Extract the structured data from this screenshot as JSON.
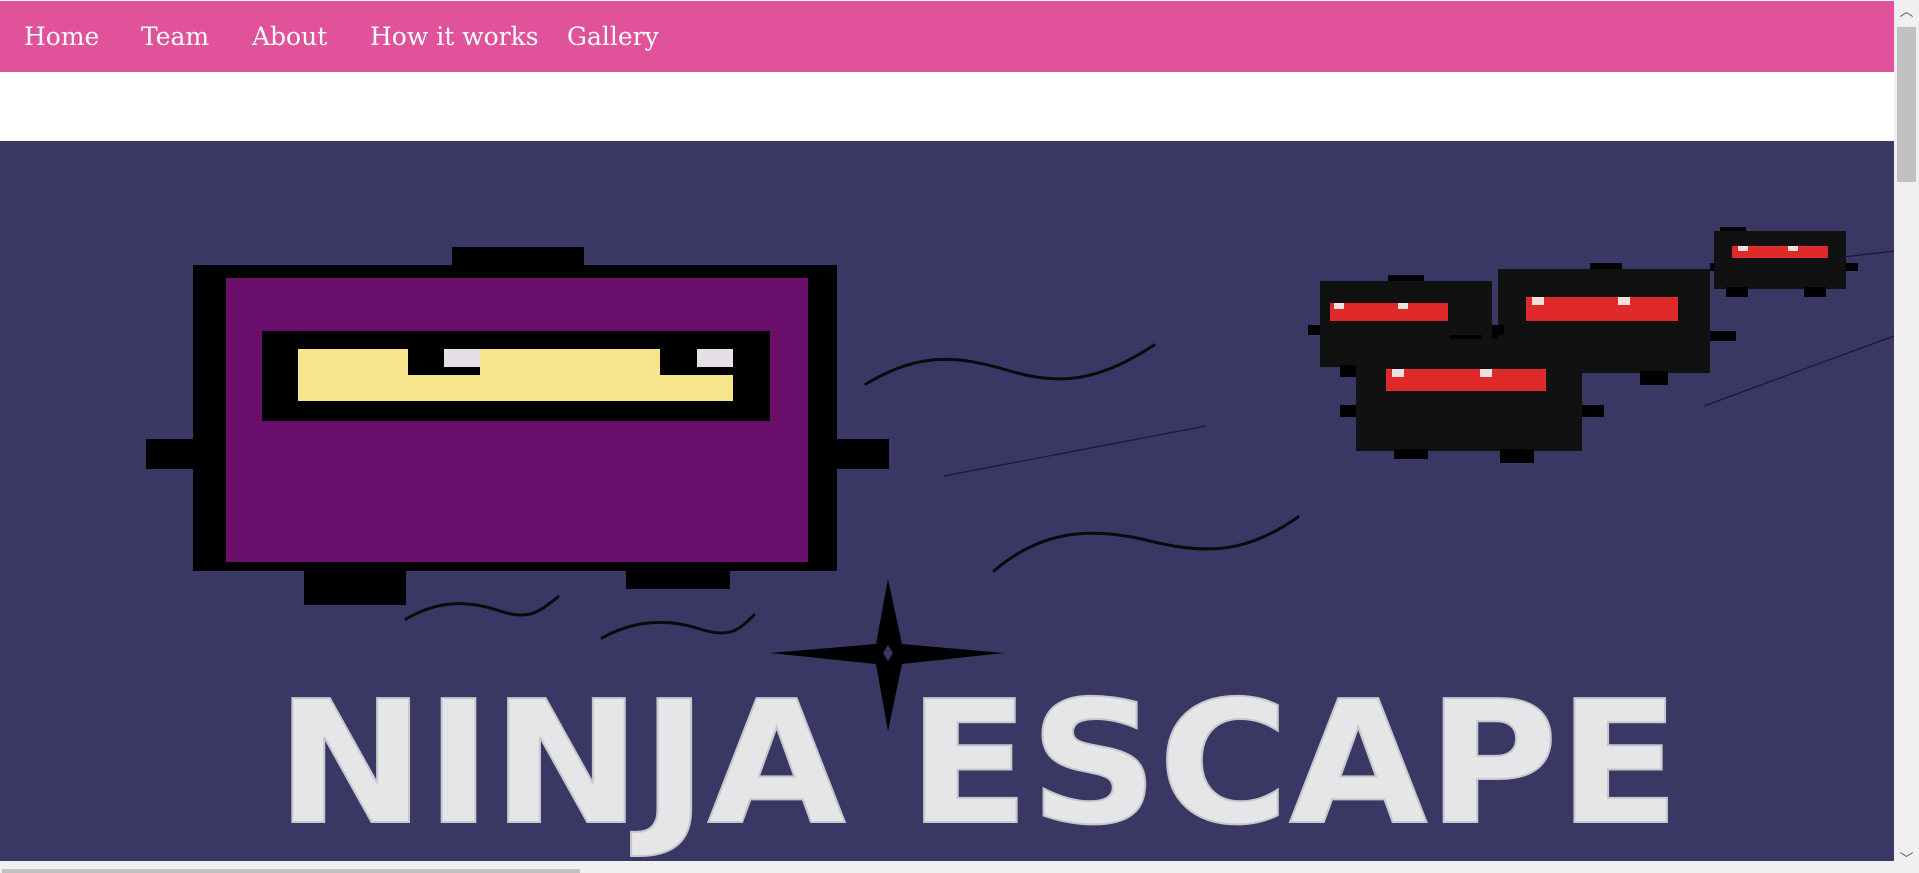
{
  "nav": {
    "items": [
      {
        "label": "Home"
      },
      {
        "label": "Team"
      },
      {
        "label": "About"
      },
      {
        "label": "How it works"
      },
      {
        "label": "Gallery"
      }
    ]
  },
  "banner": {
    "logo_text": "NINJA ESCAPE"
  },
  "colors": {
    "nav_bg": "#e0529a",
    "banner_bg": "#393865",
    "hero_ninja": "#6a0e6b",
    "hero_eyes": "#f7e58c",
    "enemy_eyes": "#e02a2a",
    "logo_text": "#e6e6e8"
  },
  "icons": [
    "shuriken-icon",
    "scroll-up-arrow-icon",
    "scroll-down-arrow-icon"
  ]
}
